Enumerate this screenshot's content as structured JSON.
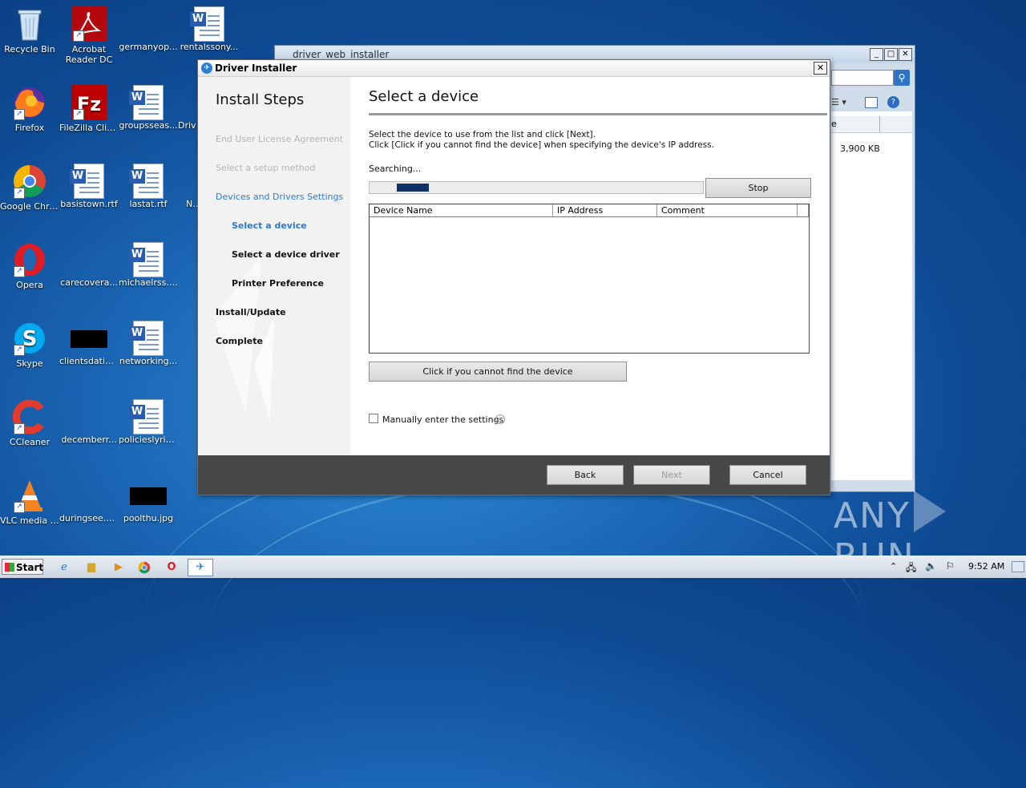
{
  "desktop_icons": [
    {
      "label": "Recycle Bin",
      "icon": "recycle-bin-icon"
    },
    {
      "label": "Acrobat Reader DC",
      "icon": "acrobat-icon"
    },
    {
      "label": "germanyop...",
      "icon": "file-icon"
    },
    {
      "label": "rentalssony...",
      "icon": "word-doc-icon"
    },
    {
      "label": "Firefox",
      "icon": "firefox-icon"
    },
    {
      "label": "FileZilla Client",
      "icon": "filezilla-icon"
    },
    {
      "label": "groupsseas...",
      "icon": "word-doc-icon"
    },
    {
      "label": "Driv",
      "icon": "file-icon"
    },
    {
      "label": "Google Chrome",
      "icon": "chrome-icon"
    },
    {
      "label": "basistown.rtf",
      "icon": "word-doc-icon"
    },
    {
      "label": "lastat.rtf",
      "icon": "word-doc-icon"
    },
    {
      "label": "Ne",
      "icon": "word-doc-icon"
    },
    {
      "label": "Opera",
      "icon": "opera-icon"
    },
    {
      "label": "carecovera...",
      "icon": "file-icon"
    },
    {
      "label": "michaelrss.rtf",
      "icon": "word-doc-icon"
    },
    {
      "label": "Skype",
      "icon": "skype-icon"
    },
    {
      "label": "clientsdatin...",
      "icon": "image-icon"
    },
    {
      "label": "networking...",
      "icon": "word-doc-icon"
    },
    {
      "label": "CCleaner",
      "icon": "ccleaner-icon"
    },
    {
      "label": "decemberr...",
      "icon": "file-icon"
    },
    {
      "label": "policieslyrics...",
      "icon": "word-doc-icon"
    },
    {
      "label": "VLC media player",
      "icon": "vlc-icon"
    },
    {
      "label": "duringsee.png",
      "icon": "file-icon"
    },
    {
      "label": "poolthu.jpg",
      "icon": "image-icon"
    }
  ],
  "explorer": {
    "title": "driver_web_installer",
    "size_value": "3,900 KB",
    "column_fragment": "e"
  },
  "dialog": {
    "title": "Driver Installer",
    "steps_heading": "Install Steps",
    "steps": [
      {
        "label": "End User License Agreement",
        "state": "done"
      },
      {
        "label": "Select a setup method",
        "state": "done"
      },
      {
        "label": "Devices and Drivers Settings",
        "state": "active"
      },
      {
        "label": "Select a device",
        "state": "active-sub"
      },
      {
        "label": "Select a device driver",
        "state": "pending-sub"
      },
      {
        "label": "Printer Preference",
        "state": "pending-sub"
      },
      {
        "label": "Install/Update",
        "state": "pending"
      },
      {
        "label": "Complete",
        "state": "pending"
      }
    ],
    "heading": "Select a device",
    "instruction_line1": "Select the device to use from the list and click [Next].",
    "instruction_line2": "Click [Click if you cannot find the device] when specifying the device's IP address.",
    "status": "Searching...",
    "stop_label": "Stop",
    "columns": [
      "Device Name",
      "IP Address",
      "Comment"
    ],
    "cannot_find_label": "Click if you cannot find the device",
    "manual_checkbox_label": "Manually enter the settings",
    "manual_checked": false,
    "back_label": "Back",
    "next_label": "Next",
    "cancel_label": "Cancel"
  },
  "taskbar": {
    "start_label": "Start",
    "apps": [
      "internet-explorer-icon",
      "folder-icon",
      "media-player-icon",
      "chrome-icon",
      "opera-icon",
      "driver-installer-icon"
    ],
    "clock": "9:52 AM"
  },
  "watermark": {
    "text_left": "ANY",
    "text_right": "RUN"
  }
}
